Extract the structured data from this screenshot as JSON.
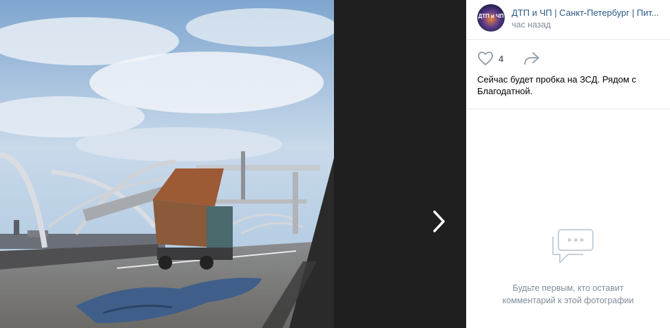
{
  "post": {
    "author": "ДТП и ЧП | Санкт-Петербург | Пит...",
    "time": "час назад",
    "likes": "4",
    "text": "Сейчас будет пробка на ЗСД. Рядом с Благодатной."
  },
  "comments": {
    "empty_text": "Будьте первым, кто оставит комментарий к этой фотографии"
  },
  "avatar": {
    "text": "ДТП и ЧП"
  },
  "icons": {
    "like": "heart-icon",
    "share": "share-arrow-icon",
    "next": "chevron-right-icon",
    "comments": "speech-bubble-icon"
  },
  "colors": {
    "link": "#2a5885",
    "secondary": "#818c99",
    "separator": "#e7e8ec"
  }
}
